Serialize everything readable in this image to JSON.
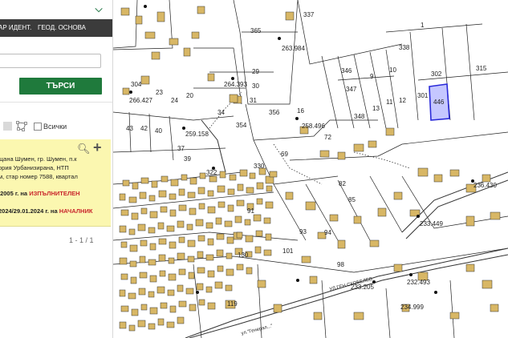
{
  "panel": {
    "tabs": [
      "АР ИДЕНТ.",
      "ГЕОД. ОСНОВА"
    ],
    "search_button": "ТЪРСИ",
    "filter_all": "Всички",
    "results": {
      "lines": [
        "щана Шумен, гр. Шумен, п.к",
        "ория Урбанизирана, НТП",
        "м, стар номер 7588, квартал"
      ],
      "status1_date": ".2005 г. на",
      "status1_state": "ИЗПЪЛНИТЕЛЕН",
      "status2_date": "2024/29.01.2024 г. на",
      "status2_state": "НАЧАЛНИК"
    },
    "pager": "1 - 1 / 1"
  },
  "map": {
    "highlighted_parcel": "446",
    "parcel_labels": [
      {
        "t": "337"
      },
      {
        "t": "365"
      },
      {
        "t": "1"
      },
      {
        "t": "338"
      },
      {
        "t": "346"
      },
      {
        "t": "9"
      },
      {
        "t": "10"
      },
      {
        "t": "302"
      },
      {
        "t": "315"
      },
      {
        "t": "347"
      },
      {
        "t": "301"
      },
      {
        "t": "446"
      },
      {
        "t": "13"
      },
      {
        "t": "11"
      },
      {
        "t": "12"
      },
      {
        "t": "348"
      },
      {
        "t": "29"
      },
      {
        "t": "30"
      },
      {
        "t": "31"
      },
      {
        "t": "356"
      },
      {
        "t": "16"
      },
      {
        "t": "354"
      },
      {
        "t": "34"
      },
      {
        "t": "72"
      },
      {
        "t": "43"
      },
      {
        "t": "42"
      },
      {
        "t": "40"
      },
      {
        "t": "37"
      },
      {
        "t": "39"
      },
      {
        "t": "69"
      },
      {
        "t": "20"
      },
      {
        "t": "23"
      },
      {
        "t": "304"
      },
      {
        "t": "24"
      },
      {
        "t": "85"
      },
      {
        "t": "82"
      },
      {
        "t": "93"
      },
      {
        "t": "94"
      },
      {
        "t": "101"
      },
      {
        "t": "98"
      },
      {
        "t": "130"
      },
      {
        "t": "119"
      },
      {
        "t": "91"
      },
      {
        "t": "322"
      },
      {
        "t": "330"
      }
    ],
    "elevation_labels": [
      {
        "t": "263.984"
      },
      {
        "t": "264.393"
      },
      {
        "t": "266.427"
      },
      {
        "t": "259.158"
      },
      {
        "t": "258.496"
      },
      {
        "t": "236.430"
      },
      {
        "t": "233.449"
      },
      {
        "t": "233.205"
      },
      {
        "t": "232.493"
      },
      {
        "t": "234.999"
      }
    ],
    "street_labels": [
      "УЛ.ГЕН.СКОБЕЛЕВ",
      "ул.\"Генерал...\""
    ]
  }
}
